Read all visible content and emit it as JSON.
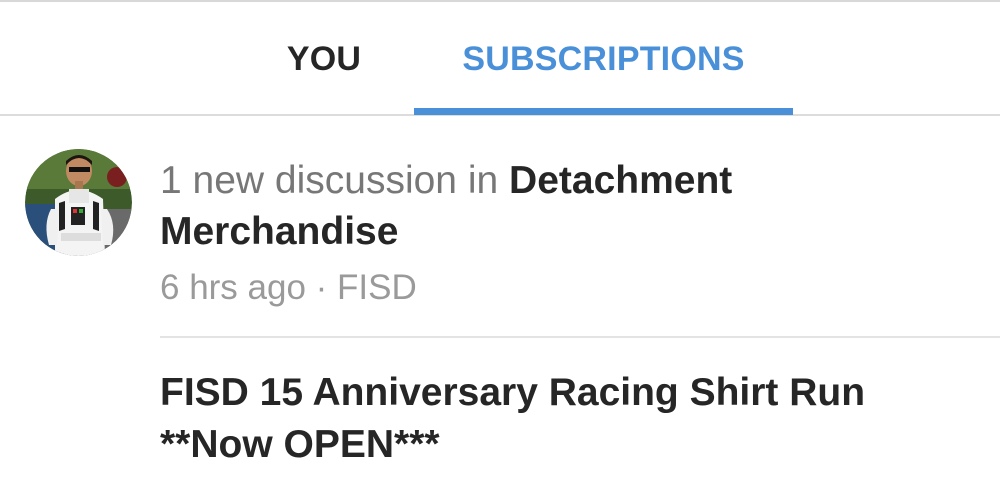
{
  "tabs": [
    {
      "label": "YOU",
      "active": false
    },
    {
      "label": "SUBSCRIPTIONS",
      "active": true
    }
  ],
  "colors": {
    "accent": "#4a90d9",
    "text_primary": "#262626",
    "text_secondary": "#777777",
    "text_meta": "#9a9a9a"
  },
  "notification": {
    "prefix": "1 new discussion in ",
    "group": "Detachment Merchandise",
    "time": "6 hrs ago",
    "separator": " · ",
    "source": "FISD",
    "avatar_icon": "user-avatar-stormtrooper"
  },
  "post": {
    "title_line1": "FISD 15 Anniversary Racing Shirt Run",
    "title_line2": "**Now OPEN***"
  }
}
